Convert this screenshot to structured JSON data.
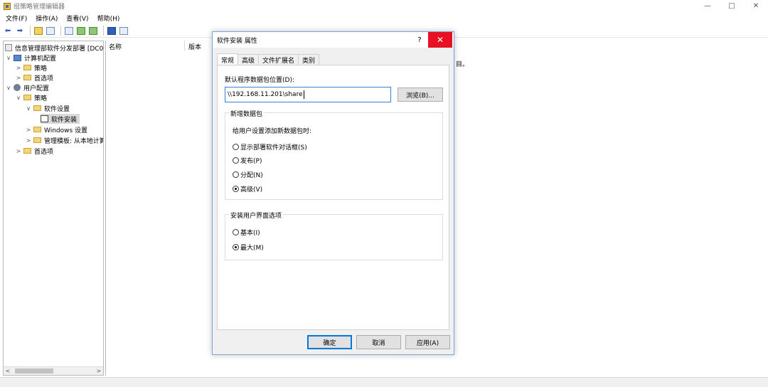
{
  "window": {
    "title": "组策略管理编辑器",
    "controls": {
      "minimize": "—",
      "maximize": "□",
      "close": "✕"
    }
  },
  "menu": [
    "文件(F)",
    "操作(A)",
    "查看(V)",
    "帮助(H)"
  ],
  "tree": {
    "root": "信息管理部软件分发部署 [DC0",
    "items": [
      {
        "label": "计算机配置",
        "icon": "computer-icon",
        "expanded": true
      },
      {
        "label": "策略",
        "icon": "folder-icon"
      },
      {
        "label": "首选项",
        "icon": "folder-icon"
      },
      {
        "label": "用户配置",
        "icon": "user-icon",
        "expanded": true
      },
      {
        "label": "策略",
        "icon": "folder-icon",
        "expanded": true
      },
      {
        "label": "软件设置",
        "icon": "folder-icon",
        "expanded": true
      },
      {
        "label": "软件安装",
        "icon": "install-icon",
        "selected": true
      },
      {
        "label": "Windows 设置",
        "icon": "folder-icon"
      },
      {
        "label": "管理模板: 从本地计算",
        "icon": "folder-icon"
      },
      {
        "label": "首选项",
        "icon": "folder-icon"
      }
    ]
  },
  "content": {
    "columns": [
      "名称",
      "版本"
    ],
    "hidden_text": "目。"
  },
  "dialog": {
    "title": "软件安装 属性",
    "help": "?",
    "close": "✕",
    "tabs": [
      "常规",
      "高级",
      "文件扩展名",
      "类别"
    ],
    "active_tab": "常规",
    "path_label": "默认程序数据包位置(D):",
    "path_value": "\\\\192.168.11.201\\share",
    "browse_label": "浏览(B)...",
    "new_package": {
      "title": "新增数据包",
      "prompt": "给用户设置添加新数据包时:",
      "options": [
        "显示部署软件对话框(S)",
        "发布(P)",
        "分配(N)",
        "高级(V)"
      ],
      "selected": "高级(V)"
    },
    "ui_options": {
      "title": "安装用户界面选项",
      "options": [
        "基本(I)",
        "最大(M)"
      ],
      "selected": "最大(M)"
    },
    "buttons": {
      "ok": "确定",
      "cancel": "取消",
      "apply": "应用(A)"
    }
  }
}
